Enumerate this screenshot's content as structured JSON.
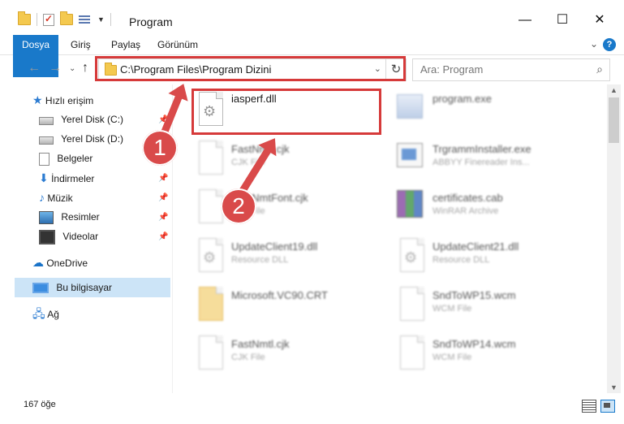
{
  "window": {
    "title": "Program",
    "controls": {
      "minimize": "—",
      "maximize": "☐",
      "close": "✕"
    }
  },
  "ribbon": {
    "tabs": [
      "Dosya",
      "Giriş",
      "Paylaş",
      "Görünüm"
    ],
    "help": "?"
  },
  "nav": {
    "address": "C:\\Program Files\\Program Dizini",
    "search_placeholder": "Ara: Program"
  },
  "sidebar": {
    "items": [
      {
        "label": "Hızlı erişim",
        "icon": "star-icon"
      },
      {
        "label": "Yerel Disk (C:)",
        "icon": "drive-icon",
        "pinned": true
      },
      {
        "label": "Yerel Disk (D:)",
        "icon": "drive-icon",
        "pinned": true
      },
      {
        "label": "Belgeler",
        "icon": "documents-icon",
        "pinned": true
      },
      {
        "label": "İndirmeler",
        "icon": "downloads-icon",
        "pinned": true
      },
      {
        "label": "Müzik",
        "icon": "music-icon",
        "pinned": true
      },
      {
        "label": "Resimler",
        "icon": "pictures-icon",
        "pinned": true
      },
      {
        "label": "Videolar",
        "icon": "videos-icon",
        "pinned": true
      },
      {
        "label": "OneDrive",
        "icon": "onedrive-icon"
      },
      {
        "label": "Bu bilgisayar",
        "icon": "this-pc-icon",
        "selected": true
      },
      {
        "label": "Ağ",
        "icon": "network-icon"
      }
    ]
  },
  "files": [
    {
      "name": "iasperf.dll",
      "type": "",
      "icon": "dll-file-icon"
    },
    {
      "name": "program.exe",
      "type": "",
      "icon": "exe-file-icon"
    },
    {
      "name": "FastNmtl.cjk",
      "type": "CJK File",
      "icon": "blank-file-icon"
    },
    {
      "name": "TrgrammInstaller.exe",
      "type": "ABBYY Finereader Ins...",
      "icon": "installer-icon"
    },
    {
      "name": "FastNmtFont.cjk",
      "type": "CJK File",
      "icon": "blank-file-icon"
    },
    {
      "name": "certificates.cab",
      "type": "WinRAR Archive",
      "icon": "winrar-icon"
    },
    {
      "name": "UpdateClient19.dll",
      "type": "Resource DLL",
      "icon": "dll-file-icon"
    },
    {
      "name": "UpdateClient21.dll",
      "type": "Resource DLL",
      "icon": "dll-file-icon"
    },
    {
      "name": "Microsoft.VC90.CRT",
      "type": "",
      "icon": "folder-icon"
    },
    {
      "name": "SndToWP15.wcm",
      "type": "WCM File",
      "icon": "blank-file-icon"
    },
    {
      "name": "FastNmtl.cjk",
      "type": "CJK File",
      "icon": "blank-file-icon"
    },
    {
      "name": "SndToWP14.wcm",
      "type": "WCM File",
      "icon": "blank-file-icon"
    }
  ],
  "annotations": {
    "badge1": "1",
    "badge2": "2",
    "color": "#d94a4a"
  },
  "status": {
    "count": "167 öğe"
  }
}
